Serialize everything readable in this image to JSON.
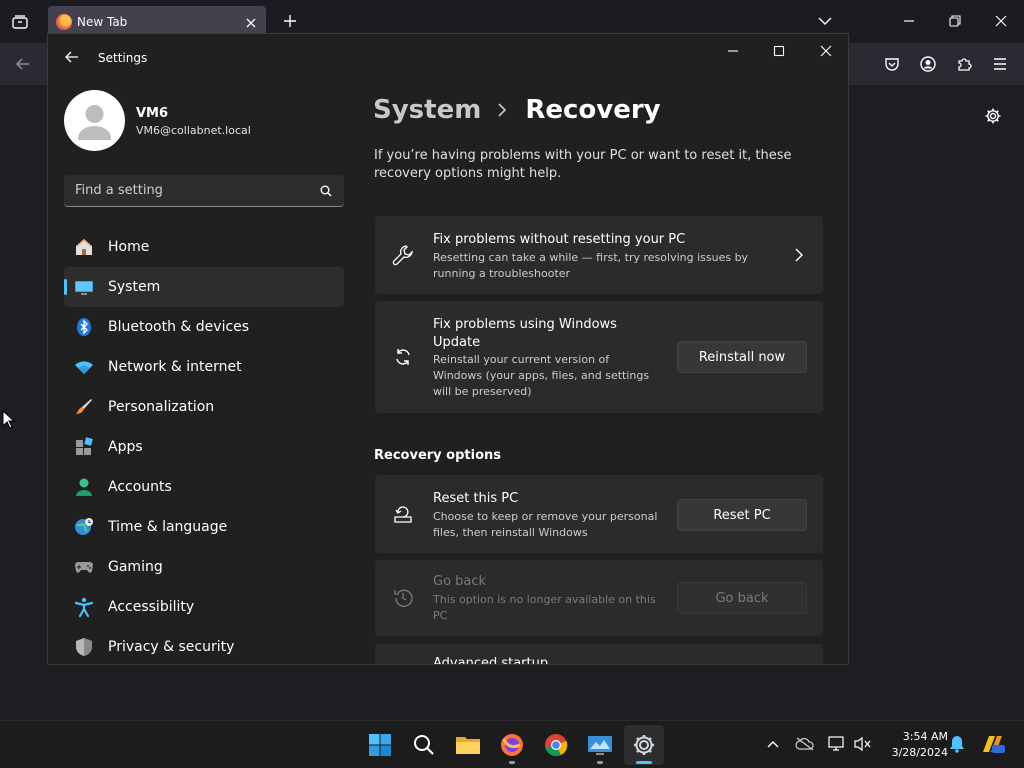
{
  "browser": {
    "tab": {
      "title": "New Tab"
    }
  },
  "settings": {
    "window_title": "Settings",
    "user": {
      "name": "VM6",
      "email": "VM6@collabnet.local"
    },
    "search": {
      "placeholder": "Find a setting"
    },
    "nav": [
      {
        "label": "Home",
        "icon": "home-icon",
        "active": false
      },
      {
        "label": "System",
        "icon": "system-icon",
        "active": true
      },
      {
        "label": "Bluetooth & devices",
        "icon": "bluetooth-icon",
        "active": false
      },
      {
        "label": "Network & internet",
        "icon": "wifi-icon",
        "active": false
      },
      {
        "label": "Personalization",
        "icon": "brush-icon",
        "active": false
      },
      {
        "label": "Apps",
        "icon": "apps-icon",
        "active": false
      },
      {
        "label": "Accounts",
        "icon": "accounts-icon",
        "active": false
      },
      {
        "label": "Time & language",
        "icon": "globe-clock-icon",
        "active": false
      },
      {
        "label": "Gaming",
        "icon": "gamepad-icon",
        "active": false
      },
      {
        "label": "Accessibility",
        "icon": "accessibility-icon",
        "active": false
      },
      {
        "label": "Privacy & security",
        "icon": "shield-icon",
        "active": false
      }
    ],
    "breadcrumb": {
      "parent": "System",
      "current": "Recovery"
    },
    "intro": "If you’re having problems with your PC or want to reset it, these recovery options might help.",
    "cards": {
      "fix_problems": {
        "title": "Fix problems without resetting your PC",
        "desc": "Resetting can take a while — first, try resolving issues by running a troubleshooter"
      },
      "windows_update": {
        "title": "Fix problems using Windows Update",
        "desc": "Reinstall your current version of Windows (your apps, files, and settings will be preserved)",
        "button": "Reinstall now"
      },
      "reset_pc": {
        "title": "Reset this PC",
        "desc": "Choose to keep or remove your personal files, then reinstall Windows",
        "button": "Reset PC"
      },
      "go_back": {
        "title": "Go back",
        "desc": "This option is no longer available on this PC",
        "button": "Go back",
        "disabled": true
      },
      "advanced_startup": {
        "title": "Advanced startup"
      }
    },
    "section_title": "Recovery options"
  },
  "taskbar": {
    "apps": [
      "start-icon",
      "search-icon",
      "file-explorer-icon",
      "firefox-icon",
      "chrome-icon",
      "app-icon",
      "settings-icon"
    ],
    "clock": {
      "time": "3:54 AM",
      "date": "3/28/2024"
    }
  },
  "colors": {
    "accent": "#4cc2ff",
    "window_bg": "#202020",
    "card_bg": "#2b2b2b"
  }
}
